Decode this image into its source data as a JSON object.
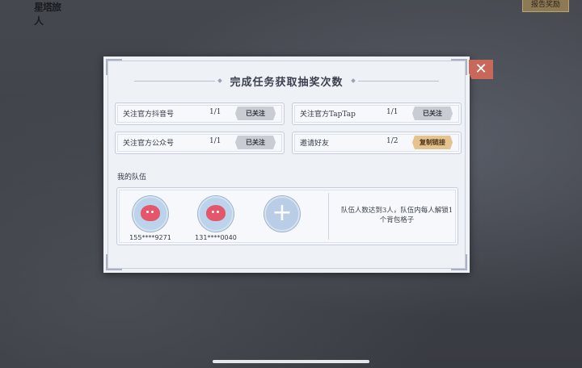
{
  "background": {
    "logo": "星塔旅人",
    "corner_button": "报告奖励"
  },
  "modal": {
    "title": "完成任务获取抽奖次数",
    "close_label": "✕",
    "tasks": [
      {
        "label": "关注官方抖音号",
        "progress": "1/1",
        "button": "已关注",
        "state": "done"
      },
      {
        "label": "关注官方TapTap",
        "progress": "1/1",
        "button": "已关注",
        "state": "done"
      },
      {
        "label": "关注官方公众号",
        "progress": "1/1",
        "button": "已关注",
        "state": "done"
      },
      {
        "label": "邀请好友",
        "progress": "1/2",
        "button": "复制链接",
        "state": "active"
      }
    ],
    "team": {
      "label": "我的队伍",
      "members": [
        {
          "id": "155****9271"
        },
        {
          "id": "131****0040"
        }
      ],
      "add_symbol": "+",
      "note": "队伍人数达到3人，队伍内每人解锁1个背包格子"
    }
  },
  "colors": {
    "accent_close": "#c8685b",
    "copy_button": "#e5c38e",
    "done_button": "#c9ccd3",
    "avatar_blob": "#e4576b"
  }
}
